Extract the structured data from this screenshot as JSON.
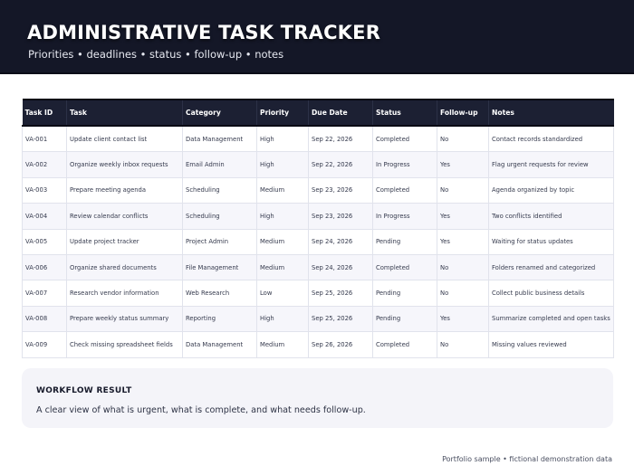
{
  "header": {
    "title": "ADMINISTRATIVE TASK TRACKER",
    "subtitle": "Priorities • deadlines • status • follow-up • notes"
  },
  "table": {
    "columns": [
      "Task ID",
      "Task",
      "Category",
      "Priority",
      "Due Date",
      "Status",
      "Follow-up",
      "Notes"
    ],
    "rows": [
      [
        "VA-001",
        "Update client contact list",
        "Data Management",
        "High",
        "Sep 22, 2026",
        "Completed",
        "No",
        "Contact records standardized"
      ],
      [
        "VA-002",
        "Organize weekly inbox requests",
        "Email Admin",
        "High",
        "Sep 22, 2026",
        "In Progress",
        "Yes",
        "Flag urgent requests for review"
      ],
      [
        "VA-003",
        "Prepare meeting agenda",
        "Scheduling",
        "Medium",
        "Sep 23, 2026",
        "Completed",
        "No",
        "Agenda organized by topic"
      ],
      [
        "VA-004",
        "Review calendar conflicts",
        "Scheduling",
        "High",
        "Sep 23, 2026",
        "In Progress",
        "Yes",
        "Two conflicts identified"
      ],
      [
        "VA-005",
        "Update project tracker",
        "Project Admin",
        "Medium",
        "Sep 24, 2026",
        "Pending",
        "Yes",
        "Waiting for status updates"
      ],
      [
        "VA-006",
        "Organize shared documents",
        "File Management",
        "Medium",
        "Sep 24, 2026",
        "Completed",
        "No",
        "Folders renamed and categorized"
      ],
      [
        "VA-007",
        "Research vendor information",
        "Web Research",
        "Low",
        "Sep 25, 2026",
        "Pending",
        "No",
        "Collect public business details"
      ],
      [
        "VA-008",
        "Prepare weekly status summary",
        "Reporting",
        "High",
        "Sep 25, 2026",
        "Pending",
        "Yes",
        "Summarize completed and open tasks"
      ],
      [
        "VA-009",
        "Check missing spreadsheet fields",
        "Data Management",
        "Medium",
        "Sep 26, 2026",
        "Completed",
        "No",
        "Missing values reviewed"
      ]
    ]
  },
  "result": {
    "heading": "WORKFLOW RESULT",
    "text": "A clear view of what is urgent, what is complete, and what needs follow-up."
  },
  "footer": {
    "text": "Portfolio sample • fictional demonstration data"
  },
  "colors": {
    "header_bg": "#141727",
    "table_header_bg": "#1c2033",
    "row_alt_bg": "#f6f6fb",
    "card_bg": "#f4f4f9"
  }
}
